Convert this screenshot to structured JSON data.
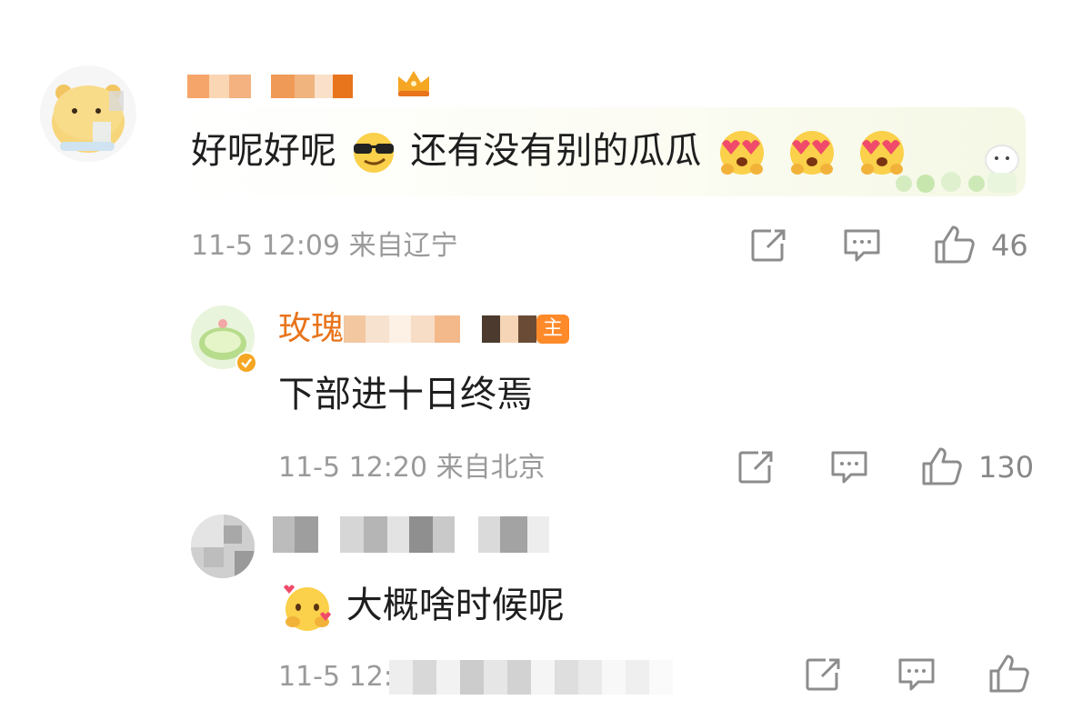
{
  "comments": [
    {
      "text_before": "好呢好呢",
      "text_after": "还有没有别的瓜瓜",
      "time": "11-5 12:09",
      "location": "来自辽宁",
      "likes": "46"
    },
    {
      "name_prefix": "玫瑰",
      "badge_text": "主",
      "text": "下部进十日终焉",
      "time": "11-5 12:20",
      "location": "来自北京",
      "likes": "130"
    },
    {
      "text": "大概啥时候呢",
      "time": "11-5 12:"
    }
  ],
  "icons": {
    "share": "share-icon",
    "comment": "comment-icon",
    "like": "thumbs-up-icon",
    "crown": "crown-icon",
    "verified": "verified-badge-icon"
  },
  "colors": {
    "meta_text": "#9a9a9a",
    "badge": "#ff8a2a",
    "vip_name": "#e8741c"
  }
}
